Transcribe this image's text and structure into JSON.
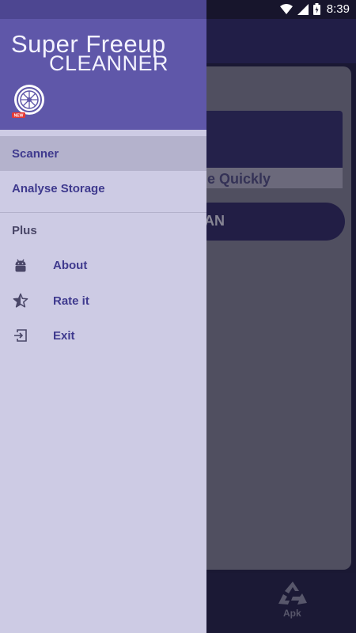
{
  "status_bar": {
    "time": "8:39"
  },
  "background_app": {
    "tagline": "e Quickly",
    "scan_button": "AN",
    "bottom_label": "Apk"
  },
  "drawer": {
    "brand_line1": "Super Freeup",
    "brand_line2": "CLEANNER",
    "logo_badge": "NEW",
    "menu": [
      {
        "label": "Scanner",
        "selected": true
      },
      {
        "label": "Analyse Storage",
        "selected": false
      }
    ],
    "section_title": "Plus",
    "plus_items": [
      {
        "label": "About",
        "icon": "android-icon"
      },
      {
        "label": "Rate it",
        "icon": "star-half-icon"
      },
      {
        "label": "Exit",
        "icon": "exit-icon"
      }
    ]
  },
  "colors": {
    "drawer_header": "#5f57a9",
    "drawer_body": "#cdcbe4",
    "accent_text": "#3f3a8e",
    "selected_row": "#b4b2cc"
  }
}
